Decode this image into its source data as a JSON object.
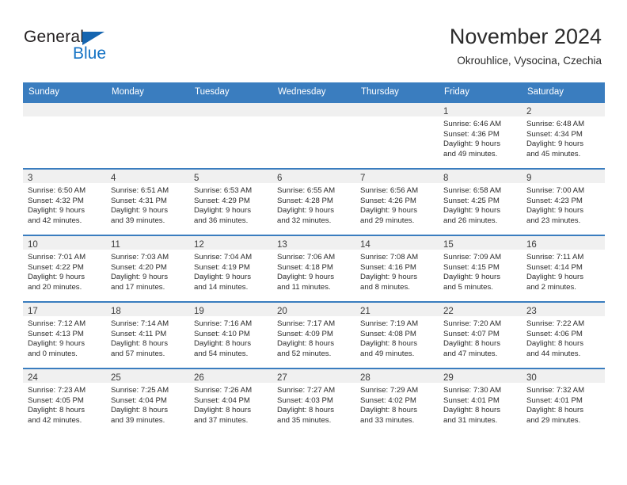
{
  "brand": {
    "name_top": "General",
    "name_bottom": "Blue",
    "color_blue": "#1372c4",
    "color_triangle": "#1565b0"
  },
  "header": {
    "title": "November 2024",
    "subtitle": "Okrouhlice, Vysocina, Czechia"
  },
  "calendar": {
    "header_bg": "#3a7dbf",
    "weekdays": [
      "Sunday",
      "Monday",
      "Tuesday",
      "Wednesday",
      "Thursday",
      "Friday",
      "Saturday"
    ],
    "weeks": [
      [
        {
          "empty": true
        },
        {
          "empty": true
        },
        {
          "empty": true
        },
        {
          "empty": true
        },
        {
          "empty": true
        },
        {
          "day": "1",
          "sunrise": "Sunrise: 6:46 AM",
          "sunset": "Sunset: 4:36 PM",
          "daylight1": "Daylight: 9 hours",
          "daylight2": "and 49 minutes."
        },
        {
          "day": "2",
          "sunrise": "Sunrise: 6:48 AM",
          "sunset": "Sunset: 4:34 PM",
          "daylight1": "Daylight: 9 hours",
          "daylight2": "and 45 minutes."
        }
      ],
      [
        {
          "day": "3",
          "sunrise": "Sunrise: 6:50 AM",
          "sunset": "Sunset: 4:32 PM",
          "daylight1": "Daylight: 9 hours",
          "daylight2": "and 42 minutes."
        },
        {
          "day": "4",
          "sunrise": "Sunrise: 6:51 AM",
          "sunset": "Sunset: 4:31 PM",
          "daylight1": "Daylight: 9 hours",
          "daylight2": "and 39 minutes."
        },
        {
          "day": "5",
          "sunrise": "Sunrise: 6:53 AM",
          "sunset": "Sunset: 4:29 PM",
          "daylight1": "Daylight: 9 hours",
          "daylight2": "and 36 minutes."
        },
        {
          "day": "6",
          "sunrise": "Sunrise: 6:55 AM",
          "sunset": "Sunset: 4:28 PM",
          "daylight1": "Daylight: 9 hours",
          "daylight2": "and 32 minutes."
        },
        {
          "day": "7",
          "sunrise": "Sunrise: 6:56 AM",
          "sunset": "Sunset: 4:26 PM",
          "daylight1": "Daylight: 9 hours",
          "daylight2": "and 29 minutes."
        },
        {
          "day": "8",
          "sunrise": "Sunrise: 6:58 AM",
          "sunset": "Sunset: 4:25 PM",
          "daylight1": "Daylight: 9 hours",
          "daylight2": "and 26 minutes."
        },
        {
          "day": "9",
          "sunrise": "Sunrise: 7:00 AM",
          "sunset": "Sunset: 4:23 PM",
          "daylight1": "Daylight: 9 hours",
          "daylight2": "and 23 minutes."
        }
      ],
      [
        {
          "day": "10",
          "sunrise": "Sunrise: 7:01 AM",
          "sunset": "Sunset: 4:22 PM",
          "daylight1": "Daylight: 9 hours",
          "daylight2": "and 20 minutes."
        },
        {
          "day": "11",
          "sunrise": "Sunrise: 7:03 AM",
          "sunset": "Sunset: 4:20 PM",
          "daylight1": "Daylight: 9 hours",
          "daylight2": "and 17 minutes."
        },
        {
          "day": "12",
          "sunrise": "Sunrise: 7:04 AM",
          "sunset": "Sunset: 4:19 PM",
          "daylight1": "Daylight: 9 hours",
          "daylight2": "and 14 minutes."
        },
        {
          "day": "13",
          "sunrise": "Sunrise: 7:06 AM",
          "sunset": "Sunset: 4:18 PM",
          "daylight1": "Daylight: 9 hours",
          "daylight2": "and 11 minutes."
        },
        {
          "day": "14",
          "sunrise": "Sunrise: 7:08 AM",
          "sunset": "Sunset: 4:16 PM",
          "daylight1": "Daylight: 9 hours",
          "daylight2": "and 8 minutes."
        },
        {
          "day": "15",
          "sunrise": "Sunrise: 7:09 AM",
          "sunset": "Sunset: 4:15 PM",
          "daylight1": "Daylight: 9 hours",
          "daylight2": "and 5 minutes."
        },
        {
          "day": "16",
          "sunrise": "Sunrise: 7:11 AM",
          "sunset": "Sunset: 4:14 PM",
          "daylight1": "Daylight: 9 hours",
          "daylight2": "and 2 minutes."
        }
      ],
      [
        {
          "day": "17",
          "sunrise": "Sunrise: 7:12 AM",
          "sunset": "Sunset: 4:13 PM",
          "daylight1": "Daylight: 9 hours",
          "daylight2": "and 0 minutes."
        },
        {
          "day": "18",
          "sunrise": "Sunrise: 7:14 AM",
          "sunset": "Sunset: 4:11 PM",
          "daylight1": "Daylight: 8 hours",
          "daylight2": "and 57 minutes."
        },
        {
          "day": "19",
          "sunrise": "Sunrise: 7:16 AM",
          "sunset": "Sunset: 4:10 PM",
          "daylight1": "Daylight: 8 hours",
          "daylight2": "and 54 minutes."
        },
        {
          "day": "20",
          "sunrise": "Sunrise: 7:17 AM",
          "sunset": "Sunset: 4:09 PM",
          "daylight1": "Daylight: 8 hours",
          "daylight2": "and 52 minutes."
        },
        {
          "day": "21",
          "sunrise": "Sunrise: 7:19 AM",
          "sunset": "Sunset: 4:08 PM",
          "daylight1": "Daylight: 8 hours",
          "daylight2": "and 49 minutes."
        },
        {
          "day": "22",
          "sunrise": "Sunrise: 7:20 AM",
          "sunset": "Sunset: 4:07 PM",
          "daylight1": "Daylight: 8 hours",
          "daylight2": "and 47 minutes."
        },
        {
          "day": "23",
          "sunrise": "Sunrise: 7:22 AM",
          "sunset": "Sunset: 4:06 PM",
          "daylight1": "Daylight: 8 hours",
          "daylight2": "and 44 minutes."
        }
      ],
      [
        {
          "day": "24",
          "sunrise": "Sunrise: 7:23 AM",
          "sunset": "Sunset: 4:05 PM",
          "daylight1": "Daylight: 8 hours",
          "daylight2": "and 42 minutes."
        },
        {
          "day": "25",
          "sunrise": "Sunrise: 7:25 AM",
          "sunset": "Sunset: 4:04 PM",
          "daylight1": "Daylight: 8 hours",
          "daylight2": "and 39 minutes."
        },
        {
          "day": "26",
          "sunrise": "Sunrise: 7:26 AM",
          "sunset": "Sunset: 4:04 PM",
          "daylight1": "Daylight: 8 hours",
          "daylight2": "and 37 minutes."
        },
        {
          "day": "27",
          "sunrise": "Sunrise: 7:27 AM",
          "sunset": "Sunset: 4:03 PM",
          "daylight1": "Daylight: 8 hours",
          "daylight2": "and 35 minutes."
        },
        {
          "day": "28",
          "sunrise": "Sunrise: 7:29 AM",
          "sunset": "Sunset: 4:02 PM",
          "daylight1": "Daylight: 8 hours",
          "daylight2": "and 33 minutes."
        },
        {
          "day": "29",
          "sunrise": "Sunrise: 7:30 AM",
          "sunset": "Sunset: 4:01 PM",
          "daylight1": "Daylight: 8 hours",
          "daylight2": "and 31 minutes."
        },
        {
          "day": "30",
          "sunrise": "Sunrise: 7:32 AM",
          "sunset": "Sunset: 4:01 PM",
          "daylight1": "Daylight: 8 hours",
          "daylight2": "and 29 minutes."
        }
      ]
    ]
  }
}
